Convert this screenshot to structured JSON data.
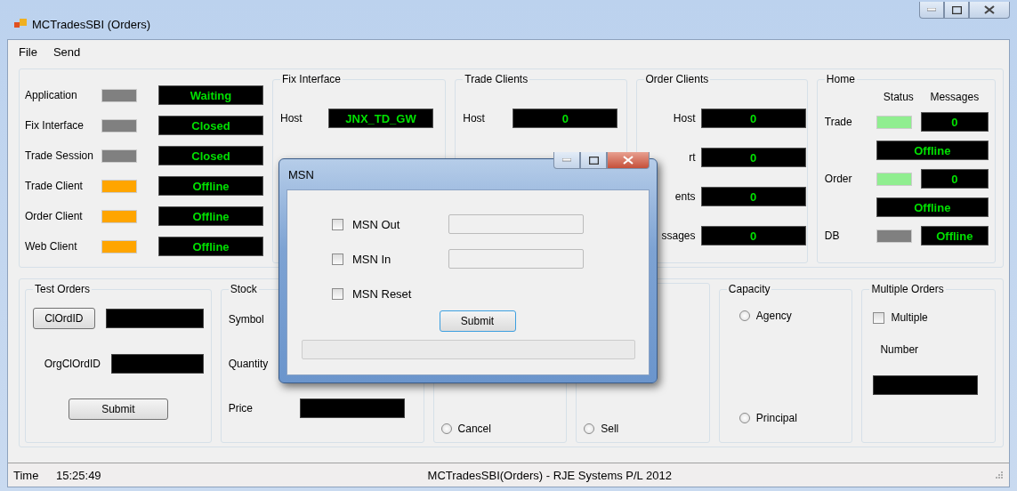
{
  "window": {
    "title": "MCTradesSBI (Orders)"
  },
  "menu": [
    "File",
    "Send"
  ],
  "status_rows": [
    {
      "label": "Application",
      "color": "#808080",
      "value": "Waiting"
    },
    {
      "label": "Fix Interface",
      "color": "#808080",
      "value": "Closed"
    },
    {
      "label": "Trade Session",
      "color": "#808080",
      "value": "Closed"
    },
    {
      "label": "Trade Client",
      "color": "#ffa500",
      "value": "Offline"
    },
    {
      "label": "Order Client",
      "color": "#ffa500",
      "value": "Offline"
    },
    {
      "label": "Web Client",
      "color": "#ffa500",
      "value": "Offline"
    }
  ],
  "fix_interface": {
    "title": "Fix Interface",
    "rows": [
      {
        "label": "Host",
        "value": "JNX_TD_GW"
      }
    ]
  },
  "trade_clients": {
    "title": "Trade Clients",
    "rows": [
      {
        "label": "Host",
        "value": "0"
      }
    ]
  },
  "order_clients": {
    "title": "Order Clients",
    "rows": [
      {
        "label": "Host",
        "value": "0"
      },
      {
        "label": "rt",
        "value": "0"
      },
      {
        "label": "ents",
        "value": "0"
      },
      {
        "label": "ssages",
        "value": "0"
      }
    ]
  },
  "home": {
    "title": "Home",
    "headers": [
      "Status",
      "Messages"
    ],
    "rows": [
      {
        "kind": "stacked",
        "label": "Trade",
        "color": "#90ee90",
        "messages": "0",
        "state": "Offline"
      },
      {
        "kind": "stacked",
        "label": "Order",
        "color": "#90ee90",
        "messages": "0",
        "state": "Offline"
      },
      {
        "kind": "inline",
        "label": "DB",
        "color": "#808080",
        "state": "Offline"
      }
    ]
  },
  "test_orders": {
    "title": "Test Orders",
    "clordid_button": "ClOrdID",
    "orgclordid_label": "OrgClOrdID",
    "submit": "Submit"
  },
  "stock": {
    "title": "Stock",
    "rows": [
      {
        "kind": "label",
        "label": "Symbol"
      },
      {
        "kind": "label",
        "label": "Quantity"
      },
      {
        "kind": "field",
        "label": "Price"
      }
    ]
  },
  "order_type": {
    "options": [
      {
        "label": "Cancel",
        "selected": false
      }
    ]
  },
  "side": {
    "options": [
      {
        "label": "Sell",
        "selected": false
      }
    ]
  },
  "capacity": {
    "title": "Capacity",
    "options": [
      {
        "label": "Agency",
        "selected": false
      },
      {
        "label": "Principal",
        "selected": false
      }
    ]
  },
  "multiple_orders": {
    "title": "Multiple Orders",
    "checkbox": {
      "label": "Multiple",
      "checked": false
    },
    "number_label": "Number"
  },
  "status_bar": {
    "time_label": "Time",
    "time": "15:25:49",
    "text": "MCTradesSBI(Orders) - RJE Systems P/L 2012"
  },
  "dialog": {
    "title": "MSN",
    "options": [
      {
        "kind": "field",
        "label": "MSN Out",
        "checked": false
      },
      {
        "kind": "field",
        "label": "MSN In",
        "checked": false
      },
      {
        "kind": "plain",
        "label": "MSN Reset",
        "checked": false
      }
    ],
    "submit": "Submit"
  }
}
